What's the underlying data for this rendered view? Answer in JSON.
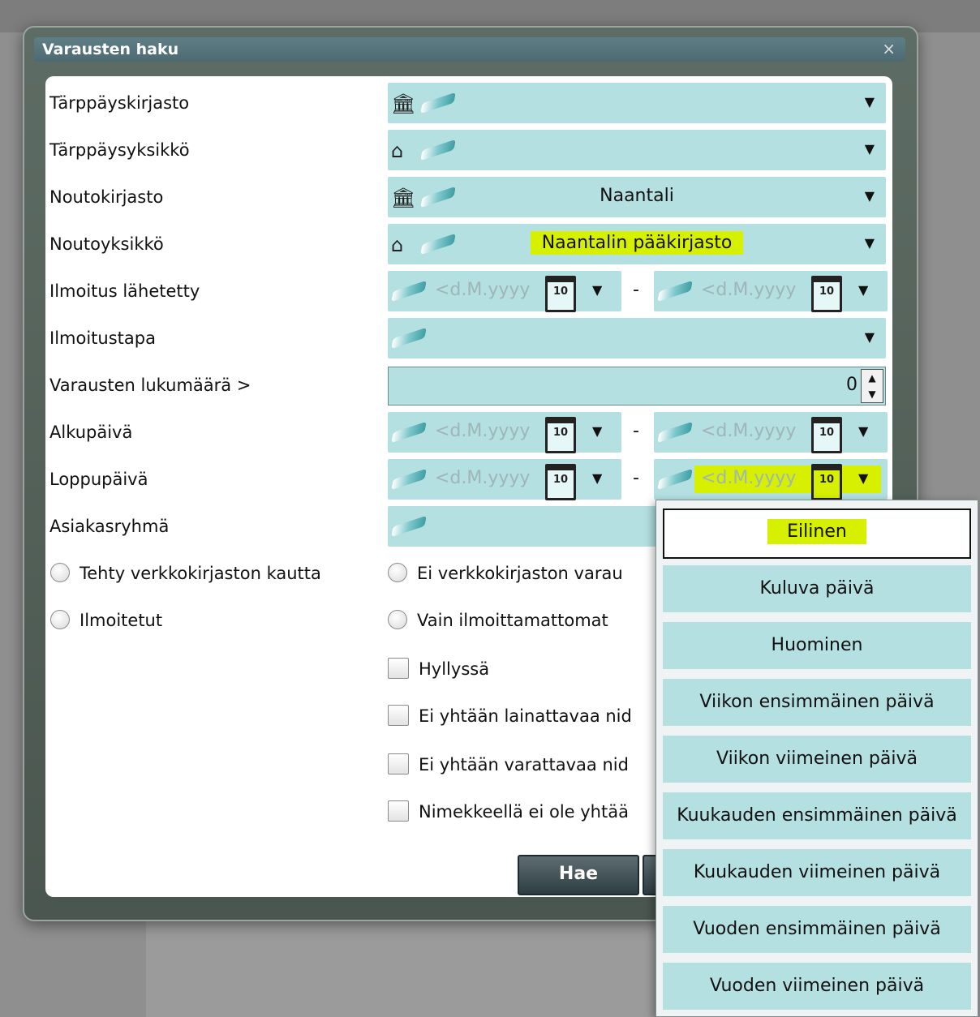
{
  "dialog": {
    "title": "Varausten haku",
    "close": "×"
  },
  "rows": {
    "tarppayskirjasto": {
      "label": "Tärppäyskirjasto",
      "value": ""
    },
    "tarppaysyksikko": {
      "label": "Tärppäysyksikkö",
      "value": ""
    },
    "noutokirjasto": {
      "label": "Noutokirjasto",
      "value": "Naantali"
    },
    "noutoyksikko": {
      "label": "Noutoyksikkö",
      "value": "Naantalin pääkirjasto"
    },
    "ilmoitus_lahetetty": {
      "label": "Ilmoitus lähetetty"
    },
    "ilmoitustapa": {
      "label": "Ilmoitustapa",
      "value": ""
    },
    "varausten_lukumaara": {
      "label": "Varausten lukumäärä >",
      "value": "0"
    },
    "alkupaiva": {
      "label": "Alkupäivä"
    },
    "loppupaiva": {
      "label": "Loppupäivä"
    },
    "asiakasryhma": {
      "label": "Asiakasryhmä"
    }
  },
  "date": {
    "placeholder": "<d.M.yyyy",
    "cal_num": "10",
    "separator": "-"
  },
  "radios": {
    "verkko": "Tehty verkkokirjaston kautta",
    "ei_verkko": "Ei verkkokirjaston varau",
    "ilmoitetut": "Ilmoitetut",
    "vain": "Vain ilmoittamattomat"
  },
  "checks": {
    "hyllyssa": "Hyllyssä",
    "lainattava": "Ei yhtään lainattavaa nid",
    "varattava": "Ei yhtään varattavaa nid",
    "nimekkeella": "Nimekkeellä ei ole yhtää"
  },
  "buttons": {
    "hae": "Hae"
  },
  "date_menu": [
    "Eilinen",
    "Kuluva päivä",
    "Huominen",
    "Viikon ensimmäinen päivä",
    "Viikon viimeinen päivä",
    "Kuukauden ensimmäinen päivä",
    "Kuukauden viimeinen päivä",
    "Vuoden ensimmäinen päivä",
    "Vuoden viimeinen päivä"
  ],
  "colors": {
    "field": "#b4e0e2",
    "highlight": "#d6f000",
    "title": "#557179"
  },
  "icons": {
    "library": "library-building-icon",
    "unit": "house-icon",
    "clear": "eraser-icon",
    "calendar": "calendar-icon",
    "dropdown": "dropdown-arrow-icon"
  }
}
